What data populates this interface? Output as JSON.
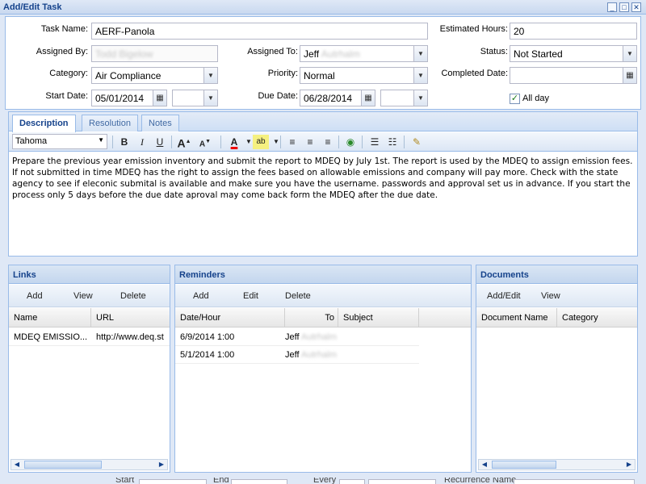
{
  "window": {
    "title": "Add/Edit Task",
    "buttons": [
      "_",
      "□",
      "✕"
    ]
  },
  "form": {
    "task_name_label": "Task Name:",
    "task_name_value": "AERF-Panola",
    "estimated_hours_label": "Estimated Hours:",
    "estimated_hours_value": "20",
    "assigned_by_label": "Assigned By:",
    "assigned_by_value": "Todd Bigelow",
    "assigned_to_label": "Assigned To:",
    "assigned_to_first": "Jeff",
    "assigned_to_last": "Autrhalm",
    "status_label": "Status:",
    "status_value": "Not Started",
    "category_label": "Category:",
    "category_value": "Air Compliance",
    "priority_label": "Priority:",
    "priority_value": "Normal",
    "completed_date_label": "Completed Date:",
    "completed_date_value": "",
    "start_date_label": "Start Date:",
    "start_date_value": "05/01/2014",
    "due_date_label": "Due Date:",
    "due_date_value": "06/28/2014",
    "all_day_label": "All day",
    "all_day_checked": true
  },
  "tabs": [
    {
      "label": "Description",
      "active": true
    },
    {
      "label": "Resolution",
      "active": false
    },
    {
      "label": "Notes",
      "active": false
    }
  ],
  "editor_toolbar": {
    "font_value": "Tahoma",
    "bold_glyph": "B",
    "italic_glyph": "I",
    "underline_glyph": "U",
    "grow_glyph": "A",
    "shrink_glyph": "A",
    "font_color_glyph": "A",
    "highlight_glyph": "ab"
  },
  "description_text": "Prepare the previous year emission inventory and submit the report to MDEQ by July 1st. The report is used by the MDEQ to assign emission fees. If not submitted in time MDEQ has the right to assign the fees based on allowable emissions and company will pay more. Check with the state agency to see if eleconic submital is available and make sure you have the username. passwords and approval set us in advance. If you start the process only 5 days before the due date aproval may come back form the MDEQ after the due date.",
  "links": {
    "title": "Links",
    "buttons": [
      "Add",
      "View",
      "Delete"
    ],
    "columns": [
      "Name",
      "URL"
    ],
    "rows": [
      {
        "name": "MDEQ EMISSIO...",
        "url": "http://www.deq.st"
      }
    ]
  },
  "reminders": {
    "title": "Reminders",
    "buttons": [
      "Add",
      "Edit",
      "Delete"
    ],
    "columns": [
      "Date/Hour",
      "To",
      "Subject"
    ],
    "rows": [
      {
        "date": "6/9/2014 1:00",
        "to_first": "Jeff",
        "to_last": "Autrhalm",
        "subject": ""
      },
      {
        "date": "5/1/2014 1:00",
        "to_first": "Jeff",
        "to_last": "Autrhalm",
        "subject": ""
      }
    ]
  },
  "documents": {
    "title": "Documents",
    "buttons": [
      "Add/Edit",
      "View"
    ],
    "columns": [
      "Document Name",
      "Category"
    ]
  },
  "bottom": {
    "start_label": "Start",
    "end_label": "End",
    "every_label": "Every",
    "recurrence_label": "Recurrence Name"
  },
  "colors": {
    "accent": "#15428b",
    "border": "#99bbe8",
    "panel_bg": "#dfe8f6"
  }
}
